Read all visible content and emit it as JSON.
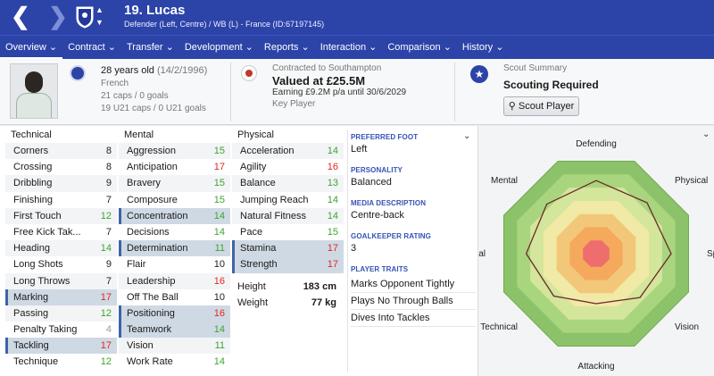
{
  "header": {
    "player_title": "19. Lucas",
    "player_subtitle": "Defender (Left, Centre) / WB (L) - France (ID:67197145)"
  },
  "menu": [
    {
      "label": "Overview ⌄"
    },
    {
      "label": "Contract ⌄"
    },
    {
      "label": "Transfer ⌄"
    },
    {
      "label": "Development ⌄"
    },
    {
      "label": "Reports ⌄"
    },
    {
      "label": "Interaction ⌄"
    },
    {
      "label": "Comparison ⌄"
    },
    {
      "label": "History ⌄"
    }
  ],
  "info": {
    "age": "28 years old",
    "dob": "(14/2/1996)",
    "nationality": "French",
    "caps": "21 caps / 0 goals",
    "u21_caps": "19 U21 caps / 0 U21 goals",
    "contract": "Contracted to Southampton",
    "value": "Valued at £25.5M",
    "earning": "Earning £9.2M p/a until 30/6/2029",
    "key_player": "Key Player",
    "scout_summary": "Scout Summary",
    "scouting_required": "Scouting Required",
    "scout_button": "Scout Player"
  },
  "attributes": {
    "technical_heading": "Technical",
    "mental_heading": "Mental",
    "physical_heading": "Physical",
    "technical": [
      {
        "name": "Corners",
        "value": "8",
        "color": "k",
        "hl": false
      },
      {
        "name": "Crossing",
        "value": "8",
        "color": "k",
        "hl": false
      },
      {
        "name": "Dribbling",
        "value": "9",
        "color": "k",
        "hl": false
      },
      {
        "name": "Finishing",
        "value": "7",
        "color": "k",
        "hl": false
      },
      {
        "name": "First Touch",
        "value": "12",
        "color": "g",
        "hl": false
      },
      {
        "name": "Free Kick Tak...",
        "value": "7",
        "color": "k",
        "hl": false
      },
      {
        "name": "Heading",
        "value": "14",
        "color": "g",
        "hl": false
      },
      {
        "name": "Long Shots",
        "value": "9",
        "color": "k",
        "hl": false
      },
      {
        "name": "Long Throws",
        "value": "7",
        "color": "k",
        "hl": false
      },
      {
        "name": "Marking",
        "value": "17",
        "color": "r",
        "hl": true
      },
      {
        "name": "Passing",
        "value": "12",
        "color": "g",
        "hl": false
      },
      {
        "name": "Penalty Taking",
        "value": "4",
        "color": "gy",
        "hl": false
      },
      {
        "name": "Tackling",
        "value": "17",
        "color": "r",
        "hl": true
      },
      {
        "name": "Technique",
        "value": "12",
        "color": "g",
        "hl": false
      }
    ],
    "mental": [
      {
        "name": "Aggression",
        "value": "15",
        "color": "g",
        "hl": false
      },
      {
        "name": "Anticipation",
        "value": "17",
        "color": "r",
        "hl": false
      },
      {
        "name": "Bravery",
        "value": "15",
        "color": "g",
        "hl": false
      },
      {
        "name": "Composure",
        "value": "15",
        "color": "g",
        "hl": false
      },
      {
        "name": "Concentration",
        "value": "14",
        "color": "g",
        "hl": true
      },
      {
        "name": "Decisions",
        "value": "14",
        "color": "g",
        "hl": false
      },
      {
        "name": "Determination",
        "value": "11",
        "color": "g",
        "hl": true
      },
      {
        "name": "Flair",
        "value": "10",
        "color": "k",
        "hl": false
      },
      {
        "name": "Leadership",
        "value": "16",
        "color": "r",
        "hl": false
      },
      {
        "name": "Off The Ball",
        "value": "10",
        "color": "k",
        "hl": false
      },
      {
        "name": "Positioning",
        "value": "16",
        "color": "r",
        "hl": true
      },
      {
        "name": "Teamwork",
        "value": "14",
        "color": "g",
        "hl": true
      },
      {
        "name": "Vision",
        "value": "11",
        "color": "g",
        "hl": false
      },
      {
        "name": "Work Rate",
        "value": "14",
        "color": "g",
        "hl": false
      }
    ],
    "physical": [
      {
        "name": "Acceleration",
        "value": "14",
        "color": "g",
        "hl": false
      },
      {
        "name": "Agility",
        "value": "16",
        "color": "r",
        "hl": false
      },
      {
        "name": "Balance",
        "value": "13",
        "color": "g",
        "hl": false
      },
      {
        "name": "Jumping Reach",
        "value": "14",
        "color": "g",
        "hl": false
      },
      {
        "name": "Natural Fitness",
        "value": "14",
        "color": "g",
        "hl": false
      },
      {
        "name": "Pace",
        "value": "15",
        "color": "g",
        "hl": false
      },
      {
        "name": "Stamina",
        "value": "17",
        "color": "r",
        "hl": true
      },
      {
        "name": "Strength",
        "value": "17",
        "color": "r",
        "hl": true
      }
    ],
    "height_label": "Height",
    "height": "183 cm",
    "weight_label": "Weight",
    "weight": "77 kg"
  },
  "details": {
    "preferred_foot_label": "PREFERRED FOOT",
    "preferred_foot": "Left",
    "personality_label": "PERSONALITY",
    "personality": "Balanced",
    "media_label": "MEDIA DESCRIPTION",
    "media": "Centre-back",
    "gk_label": "GOALKEEPER RATING",
    "gk": "3",
    "traits_label": "PLAYER TRAITS",
    "traits": [
      "Marks Opponent Tightly",
      "Plays No Through Balls",
      "Dives Into Tackles"
    ]
  },
  "radar": {
    "labels": [
      "Defending",
      "Physical",
      "Speed",
      "Vision",
      "Attacking",
      "Technical",
      "Aerial",
      "Mental"
    ],
    "rings": [
      "#8cc269",
      "#a9d57f",
      "#d3e69b",
      "#f1e9a6",
      "#f2c77a",
      "#f5a95c",
      "#ee6e6e"
    ],
    "values": [
      0.73,
      0.72,
      0.75,
      0.62,
      0.5,
      0.6,
      0.7,
      0.7
    ]
  },
  "colors": {
    "header": "#2c43a8",
    "green": "#3aa52c",
    "red": "#e0281f",
    "highlight": "#cfd9e4"
  }
}
